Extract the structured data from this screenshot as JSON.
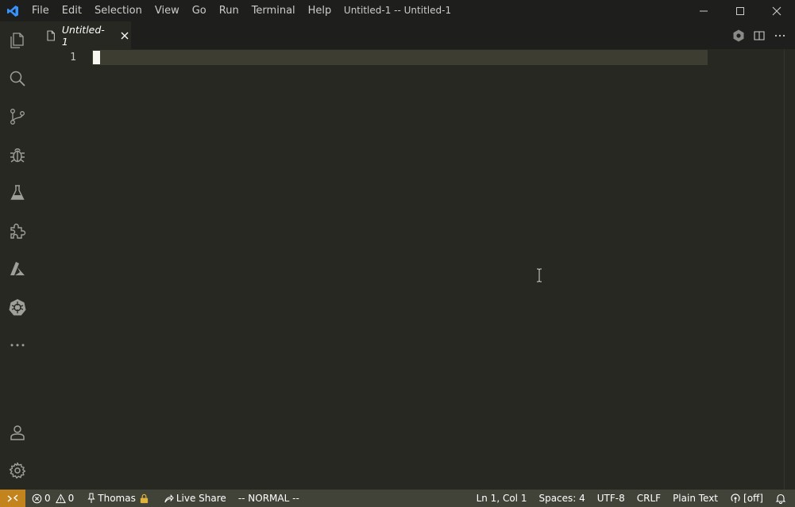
{
  "window": {
    "title": "Untitled-1 -- Untitled-1",
    "menu": [
      "File",
      "Edit",
      "Selection",
      "View",
      "Go",
      "Run",
      "Terminal",
      "Help"
    ]
  },
  "activity_bar": {
    "items": [
      {
        "name": "explorer",
        "icon": "files-icon"
      },
      {
        "name": "search",
        "icon": "search-icon"
      },
      {
        "name": "source-control",
        "icon": "source-control-icon"
      },
      {
        "name": "run-debug",
        "icon": "debug-icon"
      },
      {
        "name": "testing",
        "icon": "beaker-icon"
      },
      {
        "name": "extensions",
        "icon": "extensions-icon"
      },
      {
        "name": "azure",
        "icon": "azure-icon"
      },
      {
        "name": "kubernetes",
        "icon": "kubernetes-icon"
      },
      {
        "name": "more",
        "icon": "ellipsis-icon"
      }
    ],
    "bottom": [
      {
        "name": "accounts",
        "icon": "account-icon"
      },
      {
        "name": "manage",
        "icon": "gear-icon"
      }
    ]
  },
  "tabs": [
    {
      "label": "Untitled-1",
      "active": true,
      "icon": "file-icon"
    }
  ],
  "editor": {
    "line_numbers": [
      "1"
    ],
    "content": ""
  },
  "status_bar": {
    "errors": "0",
    "warnings": "0",
    "user": "Thomas",
    "live_share": "Live Share",
    "vim_mode": "-- NORMAL --",
    "position": "Ln 1, Col 1",
    "indentation": "Spaces: 4",
    "encoding": "UTF-8",
    "eol": "CRLF",
    "language": "Plain Text",
    "watch": "[off]"
  },
  "colors": {
    "editor_bg": "#272822",
    "titlebar_bg": "#1e1f1c",
    "statusbar_bg": "#414339",
    "remote_bg": "#c4841d",
    "logo_blue": "#3794ff"
  }
}
